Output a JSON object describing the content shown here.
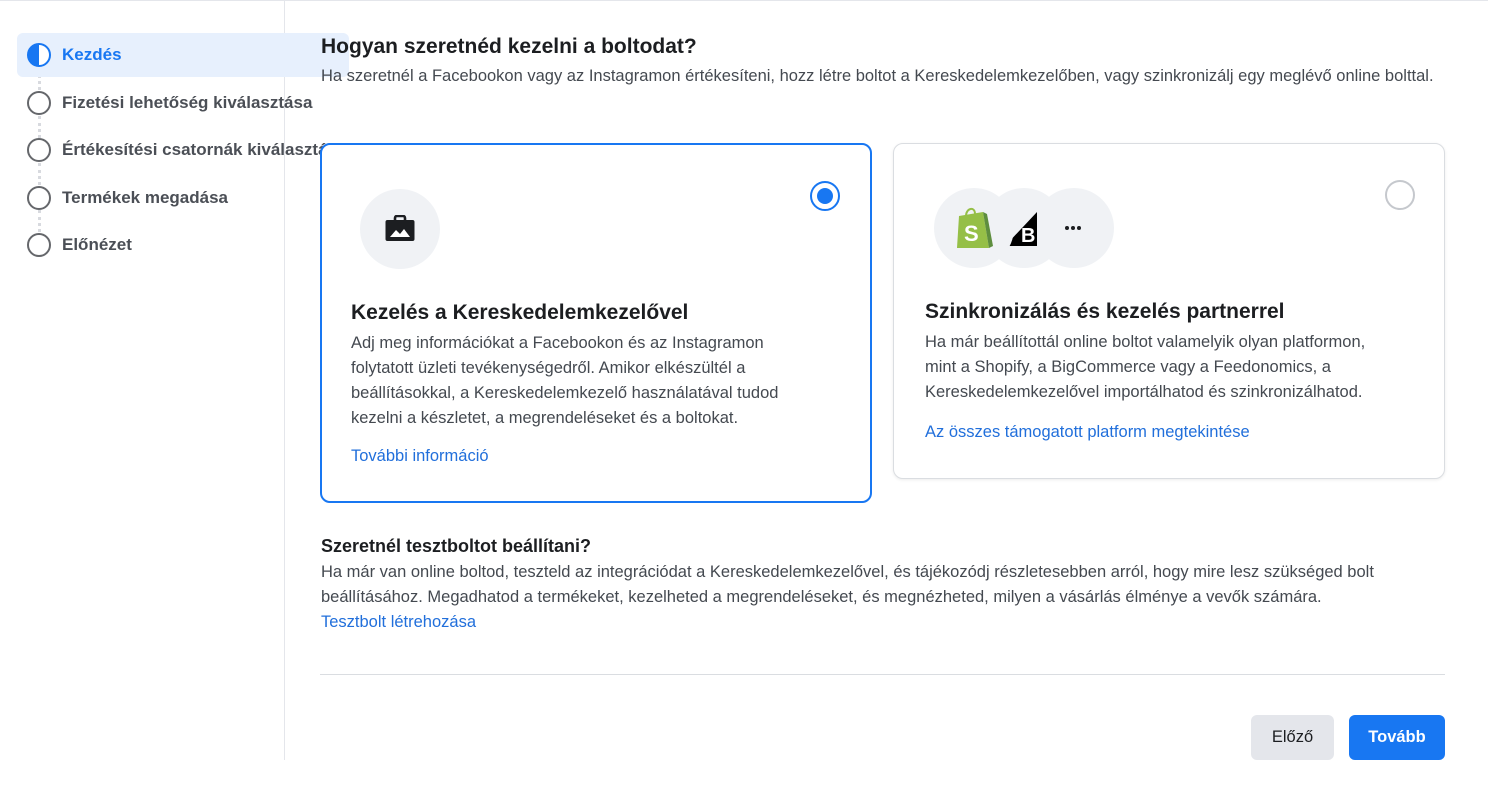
{
  "sidebar": {
    "steps": [
      {
        "label": "Kezdés",
        "state": "in-progress"
      },
      {
        "label": "Fizetési lehetőség kiválasztása",
        "state": "pending"
      },
      {
        "label": "Értékesítési csatornák kiválasztása",
        "state": "pending"
      },
      {
        "label": "Termékek megadása",
        "state": "pending"
      },
      {
        "label": "Előnézet",
        "state": "pending"
      }
    ]
  },
  "main": {
    "title": "Hogyan szeretnéd kezelni a boltodat?",
    "intro": "Ha szeretnél a Facebookon vagy az Instagramon értékesíteni, hozz létre boltot a Kereskedelemkezelőben, vagy szinkronizálj egy meglévő online bolttal.",
    "options": [
      {
        "title": "Kezelés a Kereskedelemkezelővel",
        "description": "Adj meg információkat a Facebookon és az Instagramon folytatott üzleti tevékenységedről. Amikor elkészültél a beállításokkal, a Kereskedelemkezelő használatával tudod kezelni a készletet, a megrendeléseket és a boltokat.",
        "link": "További információ",
        "selected": true,
        "icon": "briefcase-icon"
      },
      {
        "title": "Szinkronizálás és kezelés partnerrel",
        "description": "Ha már beállítottál online boltot valamelyik olyan platformon, mint a Shopify, a BigCommerce vagy a Feedonomics, a Kereskedelemkezelővel importálhatod és szinkronizálhatod.",
        "link": "Az összes támogatott platform megtekintése",
        "selected": false,
        "icons": [
          "shopify-icon",
          "bigcommerce-icon",
          "more-icon"
        ]
      }
    ],
    "test_shop": {
      "title": "Szeretnél tesztboltot beállítani?",
      "description": "Ha már van online boltod, teszteld az integrációdat a Kereskedelemkezelővel, és tájékozódj részletesebben arról, hogy mire lesz szükséged bolt beállításához. Megadhatod a termékeket, kezelheted a megrendeléseket, és megnézheted, milyen a vásárlás élménye a vevők számára.",
      "link": "Tesztbolt létrehozása"
    }
  },
  "footer": {
    "prev_label": "Előző",
    "next_label": "Tovább"
  },
  "colors": {
    "accent": "#1877f2",
    "link": "#216fdb",
    "shopify_green": "#95bf47"
  }
}
